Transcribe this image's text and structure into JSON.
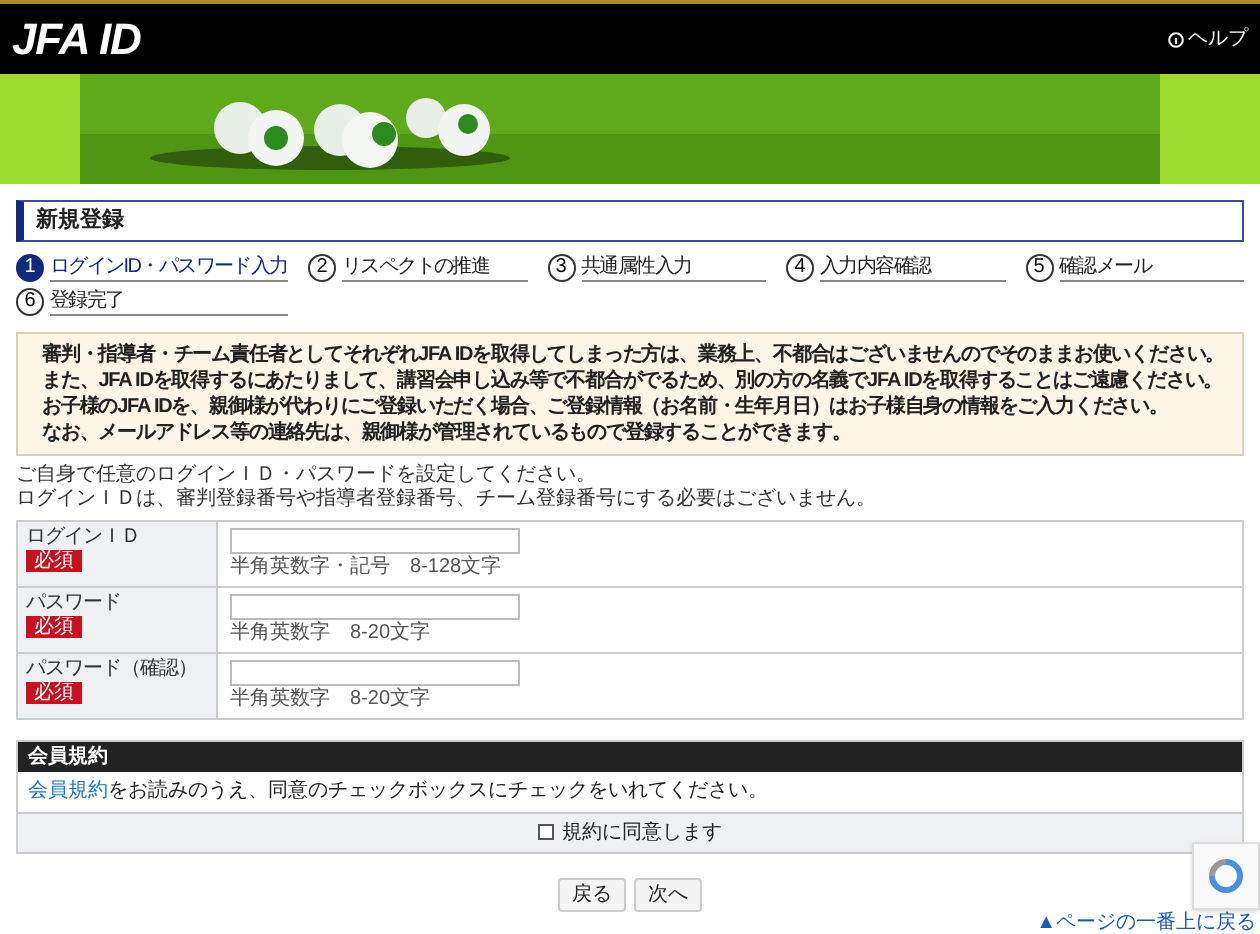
{
  "header": {
    "logo": "JFA ID",
    "help": "ヘルプ"
  },
  "banner": {
    "kind": "picture"
  },
  "page_title": "新規登録",
  "steps": [
    {
      "number": "1",
      "label": "ログインID・パスワード入力",
      "selected": true
    },
    {
      "number": "2",
      "label": "リスペクトの推進",
      "selected": false
    },
    {
      "number": "3",
      "label": "共通属性入力",
      "selected": false
    },
    {
      "number": "4",
      "label": "入力内容確認",
      "selected": false
    },
    {
      "number": "5",
      "label": "確認メール",
      "selected": false
    },
    {
      "number": "6",
      "label": "登録完了",
      "selected": false
    }
  ],
  "notice": [
    "審判・指導者・チーム責任者としてそれぞれJFA IDを取得してしまった方は、業務上、不都合はございませんのでそのままお使いください。",
    "また、JFA IDを取得するにあたりまして、講習会申し込み等で不都合がでるため、別の方の名義でJFA IDを取得することはご遠慮ください。",
    "お子様のJFA IDを、親御様が代わりにご登録いただく場合、ご登録情報（お名前・生年月日）はお子様自身の情報をご入力ください。",
    "なお、メールアドレス等の連絡先は、親御様が管理されているもので登録することができます。"
  ],
  "intro": [
    "ご自身で任意のログインＩＤ・パスワードを設定してください。",
    "ログインＩＤは、審判登録番号や指導者登録番号、チーム登録番号にする必要はございません。"
  ],
  "form": [
    {
      "label": "ログインＩＤ",
      "badge": "必須",
      "hint": "半角英数字・記号　8-128文字"
    },
    {
      "label": "パスワード",
      "badge": "必須",
      "hint": "半角英数字　8-20文字"
    },
    {
      "label": "パスワード（確認）",
      "badge": "必須",
      "hint": "半角英数字　8-20文字"
    }
  ],
  "terms": {
    "title": "会員規約",
    "link": "会員規約",
    "text": "をお読みのうえ、同意のチェックボックスにチェックをいれてください。",
    "checkbox_label": "規約に同意します",
    "checked": false
  },
  "buttons": [
    "戻る",
    "次へ"
  ],
  "page_top": "▲ページの一番上に戻る"
}
